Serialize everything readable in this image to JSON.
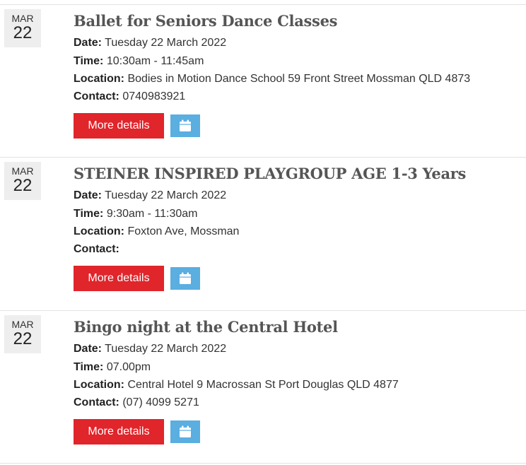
{
  "events": [
    {
      "month": "MAR",
      "day": "22",
      "title": "Ballet for Seniors Dance Classes",
      "date_label": "Date:",
      "date_value": "Tuesday 22 March 2022",
      "time_label": "Time:",
      "time_value": "10:30am - 11:45am",
      "location_label": "Location:",
      "location_value": "Bodies in Motion Dance School 59 Front Street Mossman QLD 4873",
      "contact_label": "Contact:",
      "contact_value": "0740983921",
      "more_label": "More details"
    },
    {
      "month": "MAR",
      "day": "22",
      "title": "STEINER INSPIRED PLAYGROUP AGE 1-3 Years",
      "date_label": "Date:",
      "date_value": "Tuesday 22 March 2022",
      "time_label": "Time:",
      "time_value": "9:30am - 11:30am",
      "location_label": "Location:",
      "location_value": "Foxton Ave, Mossman",
      "contact_label": "Contact:",
      "contact_value": "",
      "more_label": "More details"
    },
    {
      "month": "MAR",
      "day": "22",
      "title": "Bingo night at the Central Hotel",
      "date_label": "Date:",
      "date_value": "Tuesday 22 March 2022",
      "time_label": "Time:",
      "time_value": "07.00pm",
      "location_label": "Location:",
      "location_value": "Central Hotel 9 Macrossan St Port Douglas QLD 4877",
      "contact_label": "Contact:",
      "contact_value": "(07) 4099 5271",
      "more_label": "More details"
    }
  ],
  "icons": {
    "add_to_calendar": "calendar-icon"
  },
  "colors": {
    "more_button": "#e0252b",
    "calendar_button": "#5aaee0",
    "title": "#555555",
    "date_box": "#eeeeee"
  }
}
